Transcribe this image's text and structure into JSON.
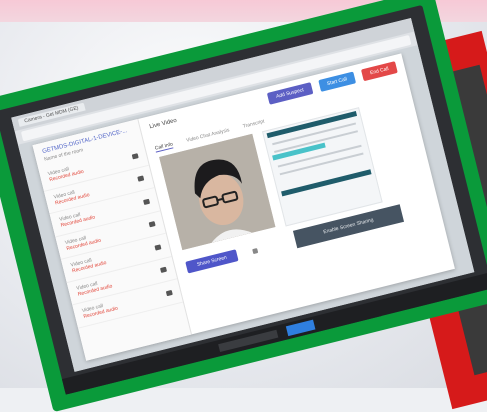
{
  "window": {
    "tab_title": "Camera - Get MDM (GE)",
    "address": ""
  },
  "modal": {
    "left_title": "GETMDS-DIGITAL-1-DEVICE-...",
    "left_subtitle": "Name of the room",
    "items": [
      {
        "line1": "Video call",
        "line2": "Recorded audio"
      },
      {
        "line1": "Video call",
        "line2": "Recorded audio"
      },
      {
        "line1": "Video call",
        "line2": "Recorded audio"
      },
      {
        "line1": "Video call",
        "line2": "Recorded audio"
      },
      {
        "line1": "Video call",
        "line2": "Recorded audio"
      },
      {
        "line1": "Video call",
        "line2": "Recorded audio"
      },
      {
        "line1": "Video call",
        "line2": "Recorded audio"
      }
    ],
    "right_title": "Live Video",
    "buttons": {
      "purple": "Add Suspect",
      "blue": "Start Call",
      "red": "End Call"
    },
    "tabs": [
      "Call Info",
      "Video Chat Analysis",
      "Transcript"
    ],
    "share_button": "Share Screen",
    "dark_bar": "Enable Screen Sharing"
  },
  "colors": {
    "green_frame": "#0a9a3a",
    "red_frame": "#d61a1a",
    "accent": "#5c5fc4"
  }
}
